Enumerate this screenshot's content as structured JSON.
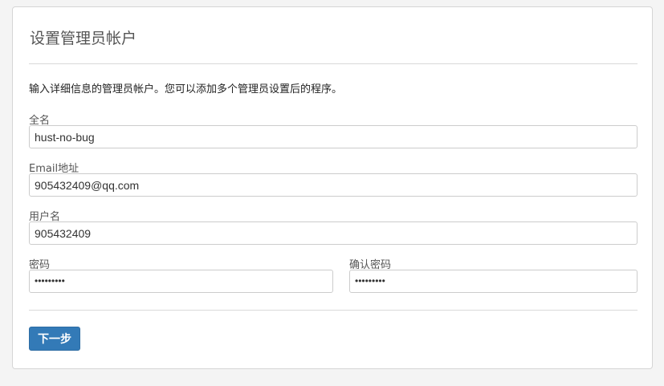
{
  "page": {
    "title": "设置管理员帐户",
    "intro": "输入详细信息的管理员帐户。您可以添加多个管理员设置后的程序。"
  },
  "form": {
    "fullname": {
      "label": "全名",
      "value": "hust-no-bug"
    },
    "email": {
      "label": "Email地址",
      "value": "905432409@qq.com"
    },
    "username": {
      "label": "用户名",
      "value": "905432409"
    },
    "password": {
      "label": "密码",
      "value": "•••••••••"
    },
    "confirm_password": {
      "label": "确认密码",
      "value": "•••••••••"
    }
  },
  "actions": {
    "next_label": "下一步"
  },
  "colors": {
    "primary_button": "#337ab7",
    "background": "#f4f4f4",
    "panel": "#ffffff"
  }
}
